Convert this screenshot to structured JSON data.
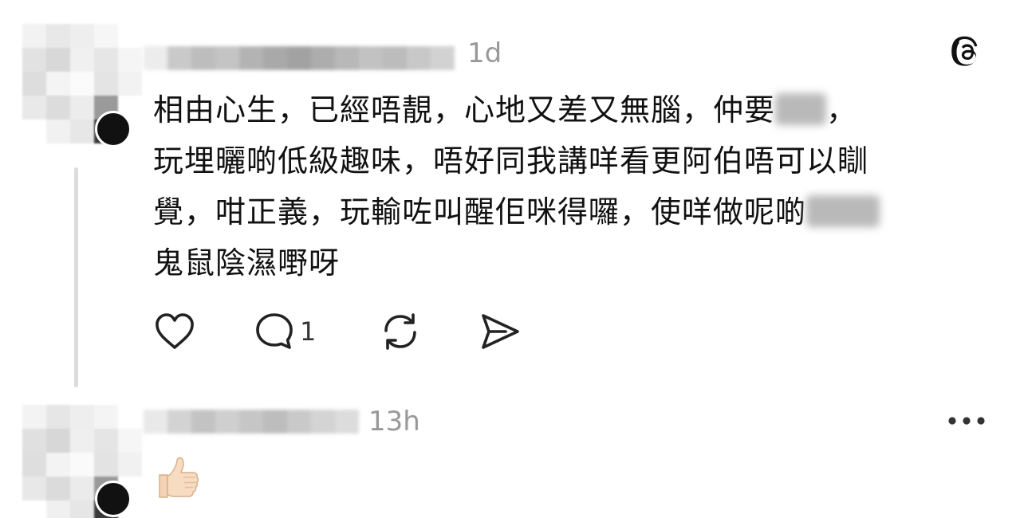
{
  "post": {
    "timestamp": "1d",
    "text_lines": [
      "相由心生，已經唔靚，心地又差又無腦，仲要",
      "玩埋曬啲低級趣味，唔好同我講咩看更阿伯唔可以瞓",
      "覺，咁正義，玩輸咗叫醒佢咪得囉，使咩做呢啲",
      "鬼鼠陰濕嘢呀"
    ],
    "text_line1_tail": "，",
    "actions": {
      "like_icon": "heart-icon",
      "reply_icon": "comment-icon",
      "reply_count": "1",
      "repost_icon": "repost-icon",
      "share_icon": "send-icon"
    }
  },
  "reply": {
    "timestamp": "13h",
    "more_icon": "more-horizontal-icon",
    "content_icon": "thumbs-up-emoji"
  },
  "app": {
    "logo_icon": "threads-logo-icon"
  },
  "colors": {
    "text": "#111111",
    "muted": "#999999",
    "thread_line": "#dcdcdc",
    "icon": "#222222"
  }
}
